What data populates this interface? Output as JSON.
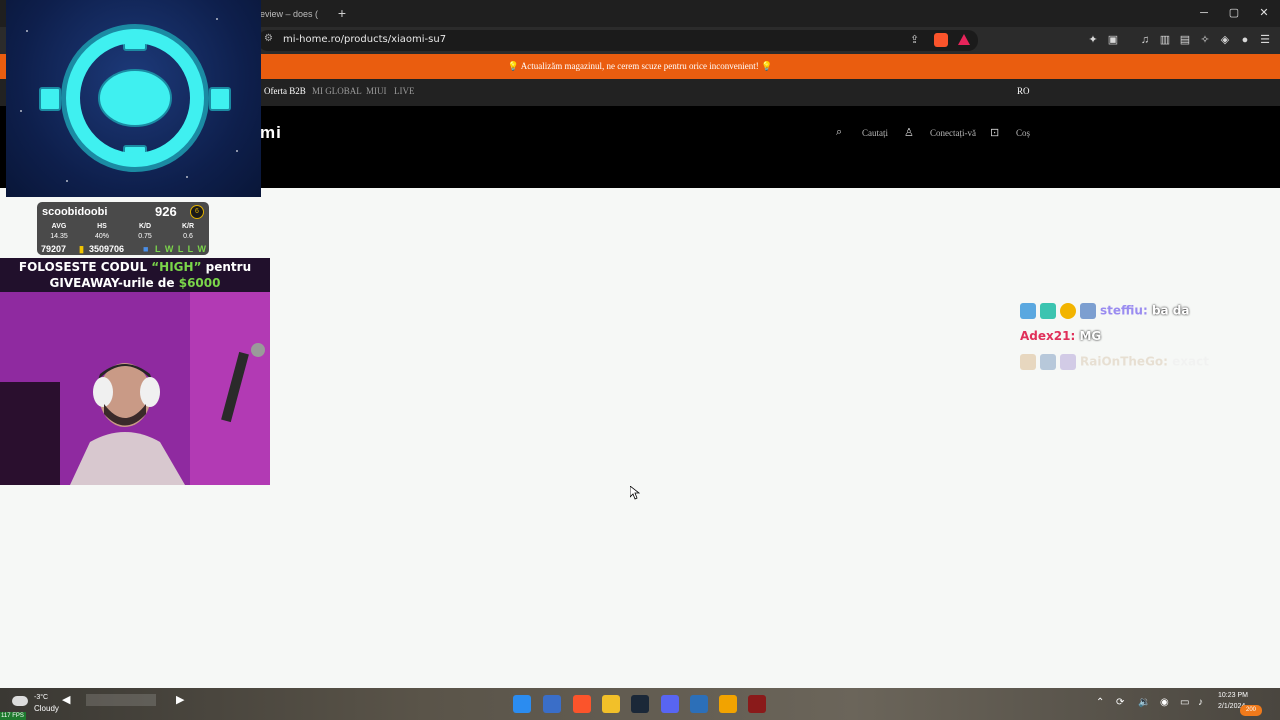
{
  "browser": {
    "tab_title": "J review – does (",
    "new_tab": "+",
    "url": "mi-home.ro/products/xiaomi-su7",
    "window_controls": {
      "minimize": "─",
      "maximize": "▢",
      "close": "✕"
    }
  },
  "site": {
    "announcement": "💡 Actualizăm magazinul, ne cerem scuze pentru orice inconvenient! 💡",
    "subnav": {
      "b2b": "Oferta B2B",
      "global": "MI GLOBAL",
      "miui": "MIUI",
      "live": "LIVE",
      "lang": "RO"
    },
    "header": {
      "logo": "mi",
      "search": "Cautați",
      "login": "Conectați-vă",
      "cart": "Coș"
    }
  },
  "stream_overlay": {
    "stats": {
      "name": "scoobidoobi",
      "rating": "926",
      "badge": "6",
      "labels": [
        "AVG",
        "HS",
        "K/D",
        "K/R"
      ],
      "values": [
        "14.35",
        "40%",
        "0.75",
        "0.6"
      ],
      "rank_left": "79207",
      "rank_right": "3509706",
      "recent": "L W L L W"
    },
    "promo_line1_a": "FOLOSESTE CODUL ",
    "promo_code": "“HIGH”",
    "promo_line1_b": " pentru",
    "promo_line2_a": "GIVEAWAY-urile de ",
    "promo_amount": "$6000",
    "chat": [
      {
        "user": "steffiu:",
        "msg": "ba da",
        "user_color": "#9a8cf0"
      },
      {
        "user": "Adex21:",
        "msg": "MG",
        "user_color": "#e0305a"
      },
      {
        "user": "RaiOnTheGo:",
        "msg": "exact",
        "user_color": "#d9c8b0"
      }
    ]
  },
  "taskbar": {
    "weather_temp": "-3°C",
    "weather_desc": "Cloudy",
    "clock_time": "10:23 PM",
    "clock_date": "2/1/2024",
    "fps": "117 FPS",
    "notification_count": "200"
  },
  "colors": {
    "announce_bg": "#ea5d0f",
    "header_bg": "#000000",
    "page_bg": "#f6f8f6",
    "crosshair": "#3ff0f0"
  }
}
